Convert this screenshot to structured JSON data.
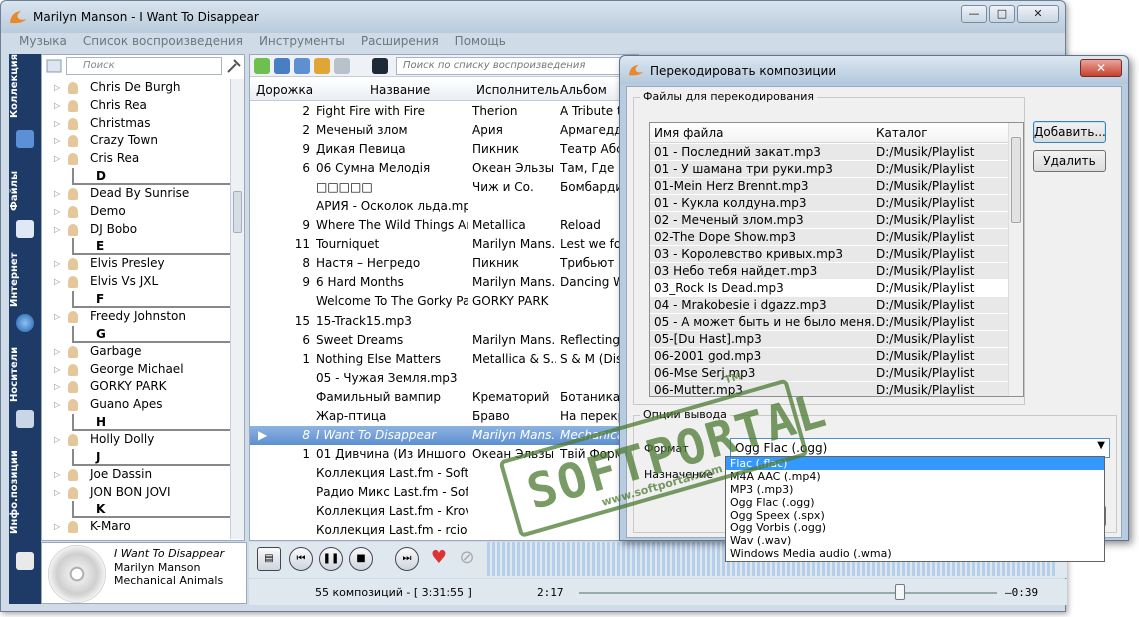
{
  "window": {
    "title": "Marilyn Manson - I Want To Disappear",
    "min": "—",
    "max": "□",
    "close": "✕"
  },
  "menu": [
    "Музыка",
    "Список воспроизведения",
    "Инструменты",
    "Расширения",
    "Помощь"
  ],
  "rail": {
    "collection": "Коллекция",
    "files": "Файлы",
    "internet": "Интернет",
    "media": "Носители",
    "info": "Инфо.позиции"
  },
  "collection": {
    "search_placeholder": "Поиск",
    "items": [
      {
        "type": "artist",
        "name": "Chris De Burgh"
      },
      {
        "type": "artist",
        "name": "Chris Rea"
      },
      {
        "type": "artist",
        "name": "Christmas"
      },
      {
        "type": "artist",
        "name": "Crazy Town"
      },
      {
        "type": "artist",
        "name": "Cris Rea"
      },
      {
        "type": "letter",
        "name": "D"
      },
      {
        "type": "artist",
        "name": "Dead By Sunrise"
      },
      {
        "type": "artist",
        "name": "Demo"
      },
      {
        "type": "artist",
        "name": "DJ Bobo"
      },
      {
        "type": "letter",
        "name": "E"
      },
      {
        "type": "artist",
        "name": "Elvis Presley"
      },
      {
        "type": "artist",
        "name": "Elvis Vs JXL"
      },
      {
        "type": "letter",
        "name": "F"
      },
      {
        "type": "artist",
        "name": "Freedy Johnston"
      },
      {
        "type": "letter",
        "name": "G"
      },
      {
        "type": "artist",
        "name": "Garbage"
      },
      {
        "type": "artist",
        "name": "George Michael"
      },
      {
        "type": "artist",
        "name": "GORKY PARK"
      },
      {
        "type": "artist",
        "name": "Guano Apes"
      },
      {
        "type": "letter",
        "name": "H"
      },
      {
        "type": "artist",
        "name": "Holly Dolly"
      },
      {
        "type": "letter",
        "name": "J"
      },
      {
        "type": "artist",
        "name": "Joe Dassin"
      },
      {
        "type": "artist",
        "name": "JON BON JOVI"
      },
      {
        "type": "letter",
        "name": "K"
      },
      {
        "type": "artist",
        "name": "K-Maro"
      }
    ]
  },
  "now_playing": {
    "title": "I Want To Disappear",
    "artist": "Marilyn Manson",
    "album": "Mechanical Animals"
  },
  "playlist": {
    "search_placeholder": "Поиск по списку воспроизведения",
    "columns": {
      "track": "Дорожка",
      "title": "Название",
      "artist": "Исполнитель",
      "album": "Альбом"
    },
    "rows": [
      {
        "num": "2",
        "title": "Fight Fire with Fire",
        "artist": "Therion",
        "album": "A Tribute to..."
      },
      {
        "num": "2",
        "title": "Меченый злом",
        "artist": "Ария",
        "album": "Армагеддон"
      },
      {
        "num": "9",
        "title": "Дикая Певица",
        "artist": "Пикник",
        "album": "Театр Абсу..."
      },
      {
        "num": "6",
        "title": "06 Сумна Мелодія",
        "artist": "Океан Эльзы",
        "album": "Там, Где На..."
      },
      {
        "num": "",
        "title": "□□□□□",
        "artist": "Чиж и Со.",
        "album": "Бомбарди..."
      },
      {
        "num": "",
        "title": "АРИЯ - Осколок льда.mp3",
        "artist": "",
        "album": ""
      },
      {
        "num": "9",
        "title": "Where The Wild Things Are",
        "artist": "Metallica",
        "album": "Reload"
      },
      {
        "num": "11",
        "title": "Tourniquet",
        "artist": "Marilyn Mans...",
        "album": "Lest we for..."
      },
      {
        "num": "8",
        "title": "Настя – Негредо",
        "artist": "Пикник",
        "album": "Трибьют"
      },
      {
        "num": "9",
        "title": "6 Hard Months",
        "artist": "Marilyn Mans...",
        "album": "Dancing Wi..."
      },
      {
        "num": "",
        "title": "Welcome To The Gorky Park",
        "artist": "GORKY PARK",
        "album": ""
      },
      {
        "num": "15",
        "title": "15-Track15.mp3",
        "artist": "",
        "album": ""
      },
      {
        "num": "6",
        "title": "Sweet Dreams",
        "artist": "Marilyn Mans...",
        "album": "Reflecting ..."
      },
      {
        "num": "1",
        "title": "Nothing Else Matters",
        "artist": "Metallica & S...",
        "album": "S & M (Disk..."
      },
      {
        "num": "",
        "title": "05 - Чужая Земля.mp3",
        "artist": "",
        "album": ""
      },
      {
        "num": "",
        "title": "Фамильный вампир",
        "artist": "Крематорий",
        "album": "Ботаника"
      },
      {
        "num": "",
        "title": "Жар-птица",
        "artist": "Браво",
        "album": "На перекр..."
      },
      {
        "num": "8",
        "title": "I Want To Disappear",
        "artist": "Marilyn Mans...",
        "album": "Mechanical...",
        "selected": true
      },
      {
        "num": "1",
        "title": "01 Дивчина (Из Иншого ...",
        "artist": "Океан Эльзы",
        "album": "Твій Форма..."
      },
      {
        "num": "",
        "title": "Коллекция Last.fm - Soft...",
        "artist": "",
        "album": ""
      },
      {
        "num": "",
        "title": "Радио Микс Last.fm  - Sof...",
        "artist": "",
        "album": ""
      },
      {
        "num": "",
        "title": "Коллекция Last.fm - Krov...",
        "artist": "",
        "album": ""
      },
      {
        "num": "",
        "title": "Коллекция Last.fm - rciob...",
        "artist": "",
        "album": ""
      }
    ]
  },
  "status": {
    "count": "55 композиций - [ 3:31:55 ]",
    "position": "2:17",
    "remaining": "–0:39"
  },
  "dialog": {
    "title": "Перекодировать композиции",
    "close": "✕",
    "files_group": "Файлы для перекодирования",
    "col_name": "Имя файла",
    "col_dir": "Каталог",
    "files": [
      {
        "name": "01 - Последний закат.mp3",
        "dir": "D:/Musik/Playlist"
      },
      {
        "name": "01 - У шамана три руки.mp3",
        "dir": "D:/Musik/Playlist"
      },
      {
        "name": "01-Mein Herz Brennt.mp3",
        "dir": "D:/Musik/Playlist"
      },
      {
        "name": "01 - Кукла колдуна.mp3",
        "dir": "D:/Musik/Playlist"
      },
      {
        "name": "02 - Меченый злом.mp3",
        "dir": "D:/Musik/Playlist"
      },
      {
        "name": "02-The Dope Show.mp3",
        "dir": "D:/Musik/Playlist"
      },
      {
        "name": "03 - Королевство кривых.mp3",
        "dir": "D:/Musik/Playlist"
      },
      {
        "name": "03 Небо тебя найдет.mp3",
        "dir": "D:/Musik/Playlist"
      },
      {
        "name": "03_Rock Is Dead.mp3",
        "dir": "D:/Musik/Playlist"
      },
      {
        "name": "04 - Mrakobesie i dgazz.mp3",
        "dir": "D:/Musik/Playlist"
      },
      {
        "name": "05 - А может быть и не было меня.mp3",
        "dir": "D:/Musik/Playlist"
      },
      {
        "name": "05-[Du Hast].mp3",
        "dir": "D:/Musik/Playlist"
      },
      {
        "name": "06-2001 god.mp3",
        "dir": "D:/Musik/Playlist"
      },
      {
        "name": "06-Mse Serj.mp3",
        "dir": "D:/Musik/Playlist"
      },
      {
        "name": "06-Mutter.mp3",
        "dir": "D:/Musik/Playlist"
      }
    ],
    "add_button": "Добавить...",
    "remove_button": "Удалить",
    "output_group": "Опции вывода",
    "format_label": "Формат",
    "dest_label": "Назначение",
    "format_value": "Ogg Flac (.ogg)",
    "format_options": [
      "Flac (.flac)",
      "M4A AAC (.mp4)",
      "MP3 (.mp3)",
      "Ogg Flac (.ogg)",
      "Ogg Speex (.spx)",
      "Ogg Vorbis (.ogg)",
      "Wav (.wav)",
      "Windows Media audio (.wma)"
    ],
    "highlighted_option": 0
  },
  "watermark": {
    "brand": "SOFTPORTAL",
    "url": "www.softportal.com",
    "tm": "TM"
  }
}
